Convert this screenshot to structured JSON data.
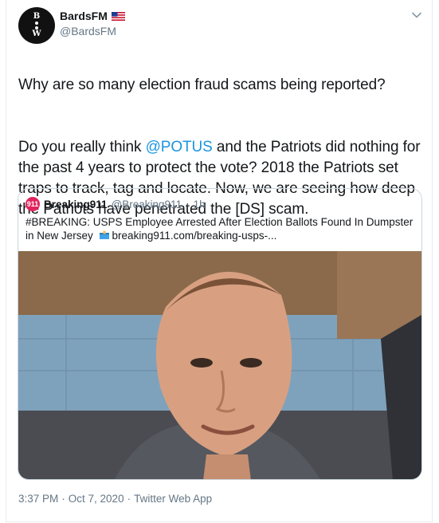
{
  "author": {
    "display_name": "BardsFM",
    "handle": "@BardsFM",
    "avatar_letters": [
      "B",
      "W"
    ],
    "flag_icon": "us-flag-icon"
  },
  "tweet": {
    "line1": "Why are so many election fraud scams being reported?",
    "p2_before": "Do you really think ",
    "p2_mention": "@POTUS",
    "p2_after": " and the Patriots did nothing for the past 4 years to protect the vote? 2018 the Patriots set traps to track, tag and locate. Now, we are seeing how deep the Patriots have penetrated the [DS] scam."
  },
  "quote": {
    "avatar_text": "911",
    "display_name": "Breaking911",
    "handle": "@Breaking911",
    "separator": "·",
    "time": "1h",
    "text_before": "#BREAKING: USPS Employee Arrested After Election Ballots Found In Dumpster in New Jersey",
    "link": "breaking911.com/breaking-usps-..."
  },
  "footer": {
    "time": "3:37 PM",
    "sep1": "·",
    "date": "Oct 7, 2020",
    "sep2": "·",
    "source": "Twitter Web App"
  },
  "colors": {
    "accent": "#1b95e0",
    "muted": "#657786",
    "border": "#ccd6dd"
  }
}
